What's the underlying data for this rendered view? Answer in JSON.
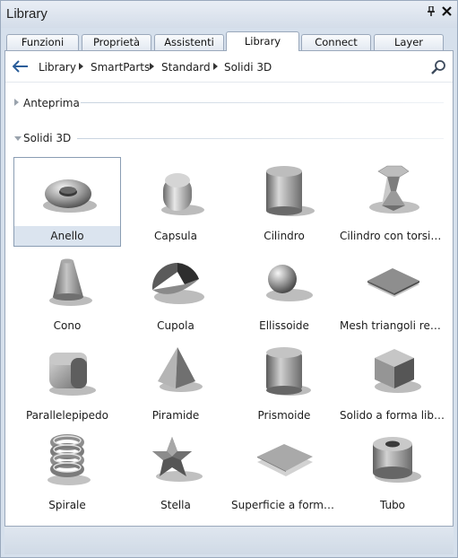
{
  "window": {
    "title": "Library"
  },
  "tabs": [
    {
      "label": "Funzioni",
      "active": false
    },
    {
      "label": "Proprietà",
      "active": false
    },
    {
      "label": "Assistenti",
      "active": false
    },
    {
      "label": "Library",
      "active": true
    },
    {
      "label": "Connect",
      "active": false
    },
    {
      "label": "Layer",
      "active": false
    }
  ],
  "breadcrumb": [
    "Library",
    "SmartParts",
    "Standard",
    "Solidi 3D"
  ],
  "sections": {
    "preview": {
      "label": "Anteprima",
      "expanded": false
    },
    "solids": {
      "label": "Solidi 3D",
      "expanded": true
    }
  },
  "items": [
    {
      "label": "Anello",
      "icon": "torus-icon",
      "selected": true
    },
    {
      "label": "Capsula",
      "icon": "capsule-icon",
      "selected": false
    },
    {
      "label": "Cilindro",
      "icon": "cylinder-icon",
      "selected": false
    },
    {
      "label": "Cilindro con torsione...",
      "icon": "twisted-cylinder-icon",
      "selected": false
    },
    {
      "label": "Cono",
      "icon": "cone-icon",
      "selected": false
    },
    {
      "label": "Cupola",
      "icon": "dome-icon",
      "selected": false
    },
    {
      "label": "Ellissoide",
      "icon": "ellipsoid-icon",
      "selected": false
    },
    {
      "label": "Mesh triangoli regol...",
      "icon": "mesh-icon",
      "selected": false
    },
    {
      "label": "Parallelepipedo",
      "icon": "rounded-box-icon",
      "selected": false
    },
    {
      "label": "Piramide",
      "icon": "pyramid-icon",
      "selected": false
    },
    {
      "label": "Prismoide",
      "icon": "prismoid-icon",
      "selected": false
    },
    {
      "label": "Solido a forma libera",
      "icon": "freeform-solid-icon",
      "selected": false
    },
    {
      "label": "Spirale",
      "icon": "spiral-icon",
      "selected": false
    },
    {
      "label": "Stella",
      "icon": "star-icon",
      "selected": false
    },
    {
      "label": "Superficie a forma li...",
      "icon": "freeform-surface-icon",
      "selected": false
    },
    {
      "label": "Tubo",
      "icon": "tube-icon",
      "selected": false
    }
  ],
  "colors": {
    "accent": "#dbe4ef",
    "chrome": "#d6e0ec",
    "border": "#9aa8bb"
  }
}
